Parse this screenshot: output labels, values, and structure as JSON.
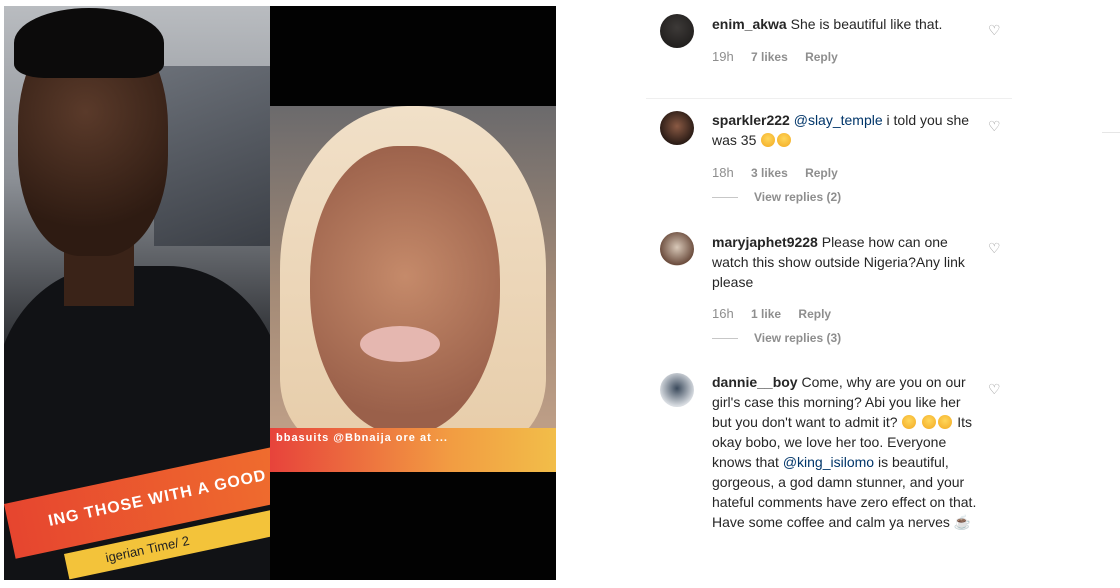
{
  "photos": {
    "left_banner": "ING THOSE WITH A GOOD LIF",
    "left_subbanner": "igerian Time/ 2",
    "right_band": "bbasuits  @Bbnaija   ore at  ..."
  },
  "comments": [
    {
      "username": "enim_akwa",
      "text": "She is beautiful like that.",
      "time": "19h",
      "likes": "7 likes",
      "reply": "Reply"
    },
    {
      "username": "sparkler222",
      "mention": "@slay_temple",
      "text": " i told you she was 35",
      "time": "18h",
      "likes": "3 likes",
      "reply": "Reply",
      "view_replies": "View replies (2)"
    },
    {
      "username": "maryjaphet9228",
      "text": "Please how can one watch this show outside Nigeria?Any link please",
      "time": "16h",
      "likes": "1 like",
      "reply": "Reply",
      "view_replies": "View replies (3)"
    },
    {
      "username": "dannie__boy",
      "text_a": "Come, why are you on our girl's case this morning? Abi you like her but you don't want to admit it?",
      "text_b": " Its okay bobo, we love her too. Everyone knows that ",
      "mention": "@king_isilomo",
      "text_c": " is beautiful, gorgeous, a god damn stunner, and your hateful comments have zero effect on that. Have some coffee and calm ya nerves ☕"
    }
  ],
  "icons": {
    "heart": "heart-outline-icon",
    "emoji": "rolling-laughing-emoji"
  }
}
